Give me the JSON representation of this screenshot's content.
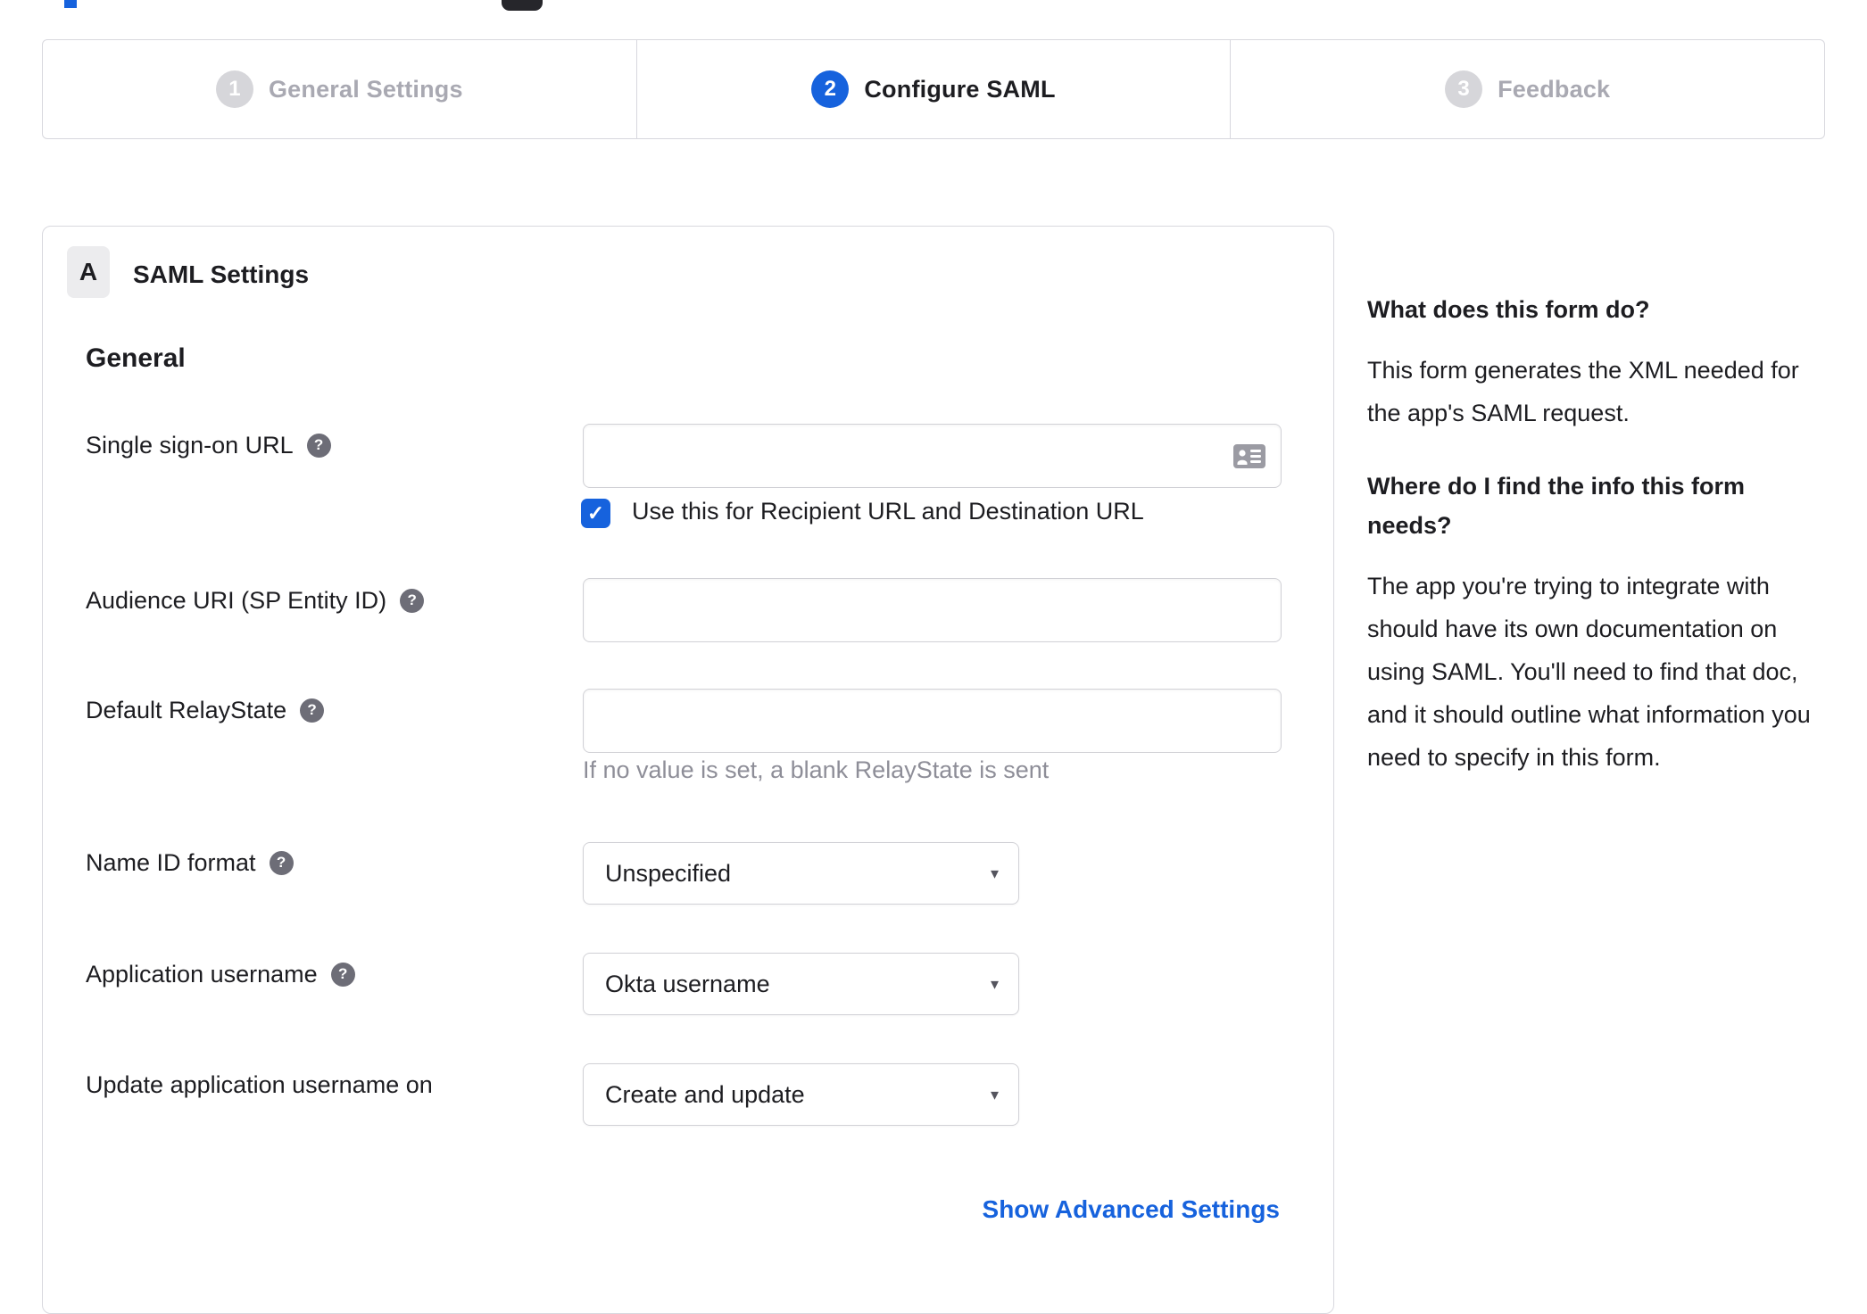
{
  "colors": {
    "accent_blue": "#1662dd",
    "inactive_gray": "#d6d6da",
    "inactive_label_gray": "#a9a9b2",
    "border_gray": "#d8d8de",
    "hint_gray": "#8e8e98",
    "text_dark": "#1d1d21",
    "help_icon_gray": "#6d6d77"
  },
  "icons": {
    "help": "?",
    "check": "✓",
    "select_caret": "▾",
    "sso_field_icon": "contact-card"
  },
  "stepper": {
    "steps": [
      {
        "number": "1",
        "label": "General Settings",
        "state": "inactive"
      },
      {
        "number": "2",
        "label": "Configure SAML",
        "state": "active"
      },
      {
        "number": "3",
        "label": "Feedback",
        "state": "inactive"
      }
    ]
  },
  "panel": {
    "badge": "A",
    "title": "SAML Settings",
    "section_heading": "General",
    "fields": [
      {
        "label": "Single sign-on URL",
        "type": "text",
        "value": "",
        "checkbox_label": "Use this for Recipient URL and Destination URL",
        "checkbox_checked": true
      },
      {
        "label": "Audience URI (SP Entity ID)",
        "type": "text",
        "value": ""
      },
      {
        "label": "Default RelayState",
        "type": "text",
        "value": "",
        "hint": "If no value is set, a blank RelayState is sent"
      },
      {
        "label": "Name ID format",
        "type": "select",
        "value": "Unspecified"
      },
      {
        "label": "Application username",
        "type": "select",
        "value": "Okta username"
      },
      {
        "label": "Update application username on",
        "type": "select",
        "value": "Create and update"
      }
    ],
    "advanced_link": "Show Advanced Settings"
  },
  "help_panel": {
    "sections": [
      {
        "heading": "What does this form do?",
        "body": "This form generates the XML needed for the app's SAML request."
      },
      {
        "heading": "Where do I find the info this form needs?",
        "body": "The app you're trying to integrate with should have its own documentation on using SAML. You'll need to find that doc, and it should outline what information you need to specify in this form."
      }
    ]
  }
}
